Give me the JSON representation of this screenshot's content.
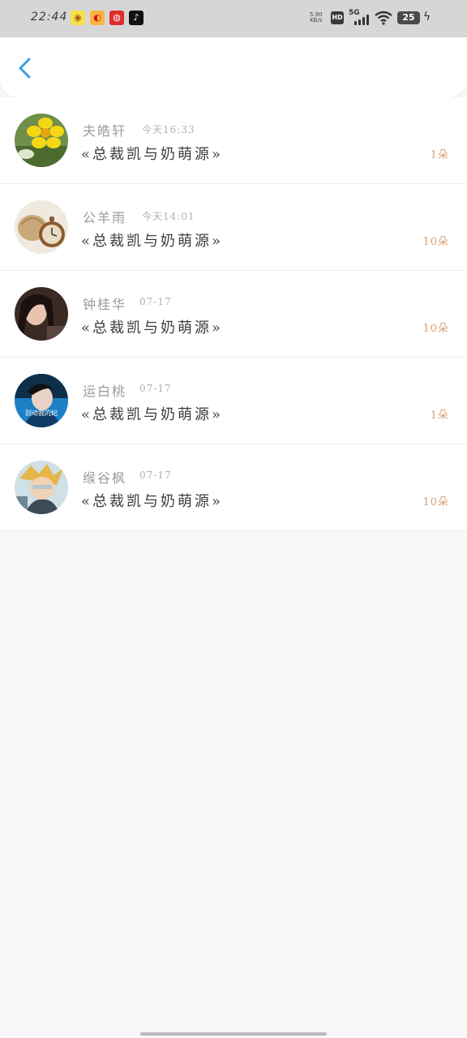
{
  "status_bar": {
    "time": "22:44",
    "apps": [
      {
        "icon": "app-icon-1",
        "glyph": "◉",
        "bg": "#f7e04a"
      },
      {
        "icon": "weibo-icon",
        "glyph": "◐",
        "bg": "#ffb340"
      },
      {
        "icon": "netease-music-icon",
        "glyph": "◍",
        "bg": "#e22b2b"
      },
      {
        "icon": "tiktok-icon",
        "glyph": "♪",
        "bg": "#111111"
      }
    ],
    "net_speed_value": "5.90",
    "net_speed_unit": "KB/s",
    "hd": "HD",
    "network": "5G",
    "battery": "25"
  },
  "header": {
    "back_icon": "chevron-left-icon",
    "accent": "#3aa0e0"
  },
  "list": [
    {
      "name": "夫皓轩",
      "time": "今天16:33",
      "title": "«总裁凯与奶萌源»",
      "gift": "1朵",
      "avatar": "yellow-flower"
    },
    {
      "name": "公羊雨",
      "time": "今天14:01",
      "title": "«总裁凯与奶萌源»",
      "gift": "10朵",
      "avatar": "pocket-watch"
    },
    {
      "name": "钟桂华",
      "time": "07-17",
      "title": "«总裁凯与奶萌源»",
      "gift": "10朵",
      "avatar": "girl-dark"
    },
    {
      "name": "运白桃",
      "time": "07-17",
      "title": "«总裁凯与奶萌源»",
      "gift": "1朵",
      "avatar": "boy-blue",
      "avatar_caption": "别动我的妃"
    },
    {
      "name": "缑谷枫",
      "time": "07-17",
      "title": "«总裁凯与奶萌源»",
      "gift": "10朵",
      "avatar": "cartoon-hero"
    }
  ]
}
